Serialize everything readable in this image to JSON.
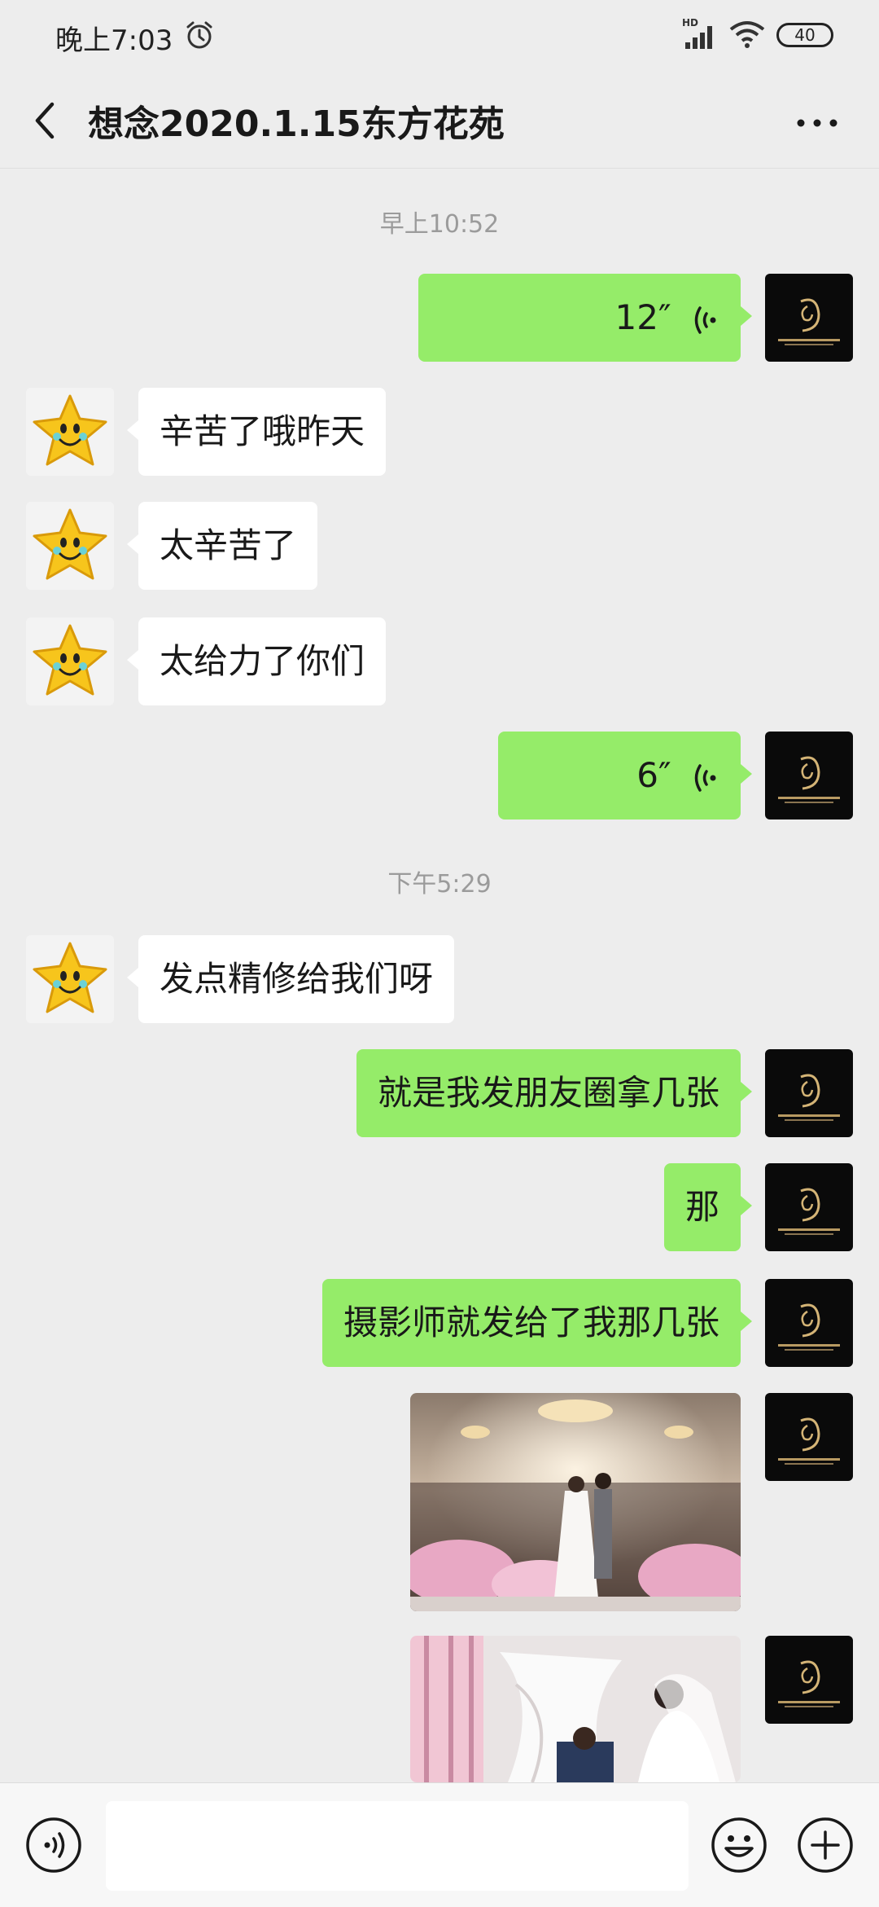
{
  "status_bar": {
    "time": "晚上7:03",
    "network": "HD",
    "battery": "40"
  },
  "header": {
    "title": "想念2020.1.15东方花苑"
  },
  "timestamps": [
    "早上10:52",
    "下午5:29"
  ],
  "messages": [
    {
      "side": "out",
      "type": "voice",
      "text": "12″"
    },
    {
      "side": "in",
      "type": "text",
      "text": "辛苦了哦昨天"
    },
    {
      "side": "in",
      "type": "text",
      "text": "太辛苦了"
    },
    {
      "side": "in",
      "type": "text",
      "text": "太给力了你们"
    },
    {
      "side": "out",
      "type": "voice",
      "text": "6″"
    },
    {
      "side": "in",
      "type": "text",
      "text": "发点精修给我们呀"
    },
    {
      "side": "out",
      "type": "text",
      "text": "就是我发朋友圈拿几张"
    },
    {
      "side": "out",
      "type": "text",
      "text": "那"
    },
    {
      "side": "out",
      "type": "text",
      "text": "摄影师就发给了我那几张"
    },
    {
      "side": "out",
      "type": "image"
    },
    {
      "side": "out",
      "type": "image"
    }
  ],
  "icons": {
    "back": "back-arrow-icon",
    "more": "more-icon",
    "voice_mode": "voice-mode-icon",
    "emoji": "emoji-icon",
    "plus": "plus-icon",
    "contact_avatar": "star-avatar",
    "own_avatar": "black-logo-avatar"
  },
  "colors": {
    "out_bubble": "#95ec69",
    "in_bubble": "#ffffff",
    "background": "#ededed"
  }
}
